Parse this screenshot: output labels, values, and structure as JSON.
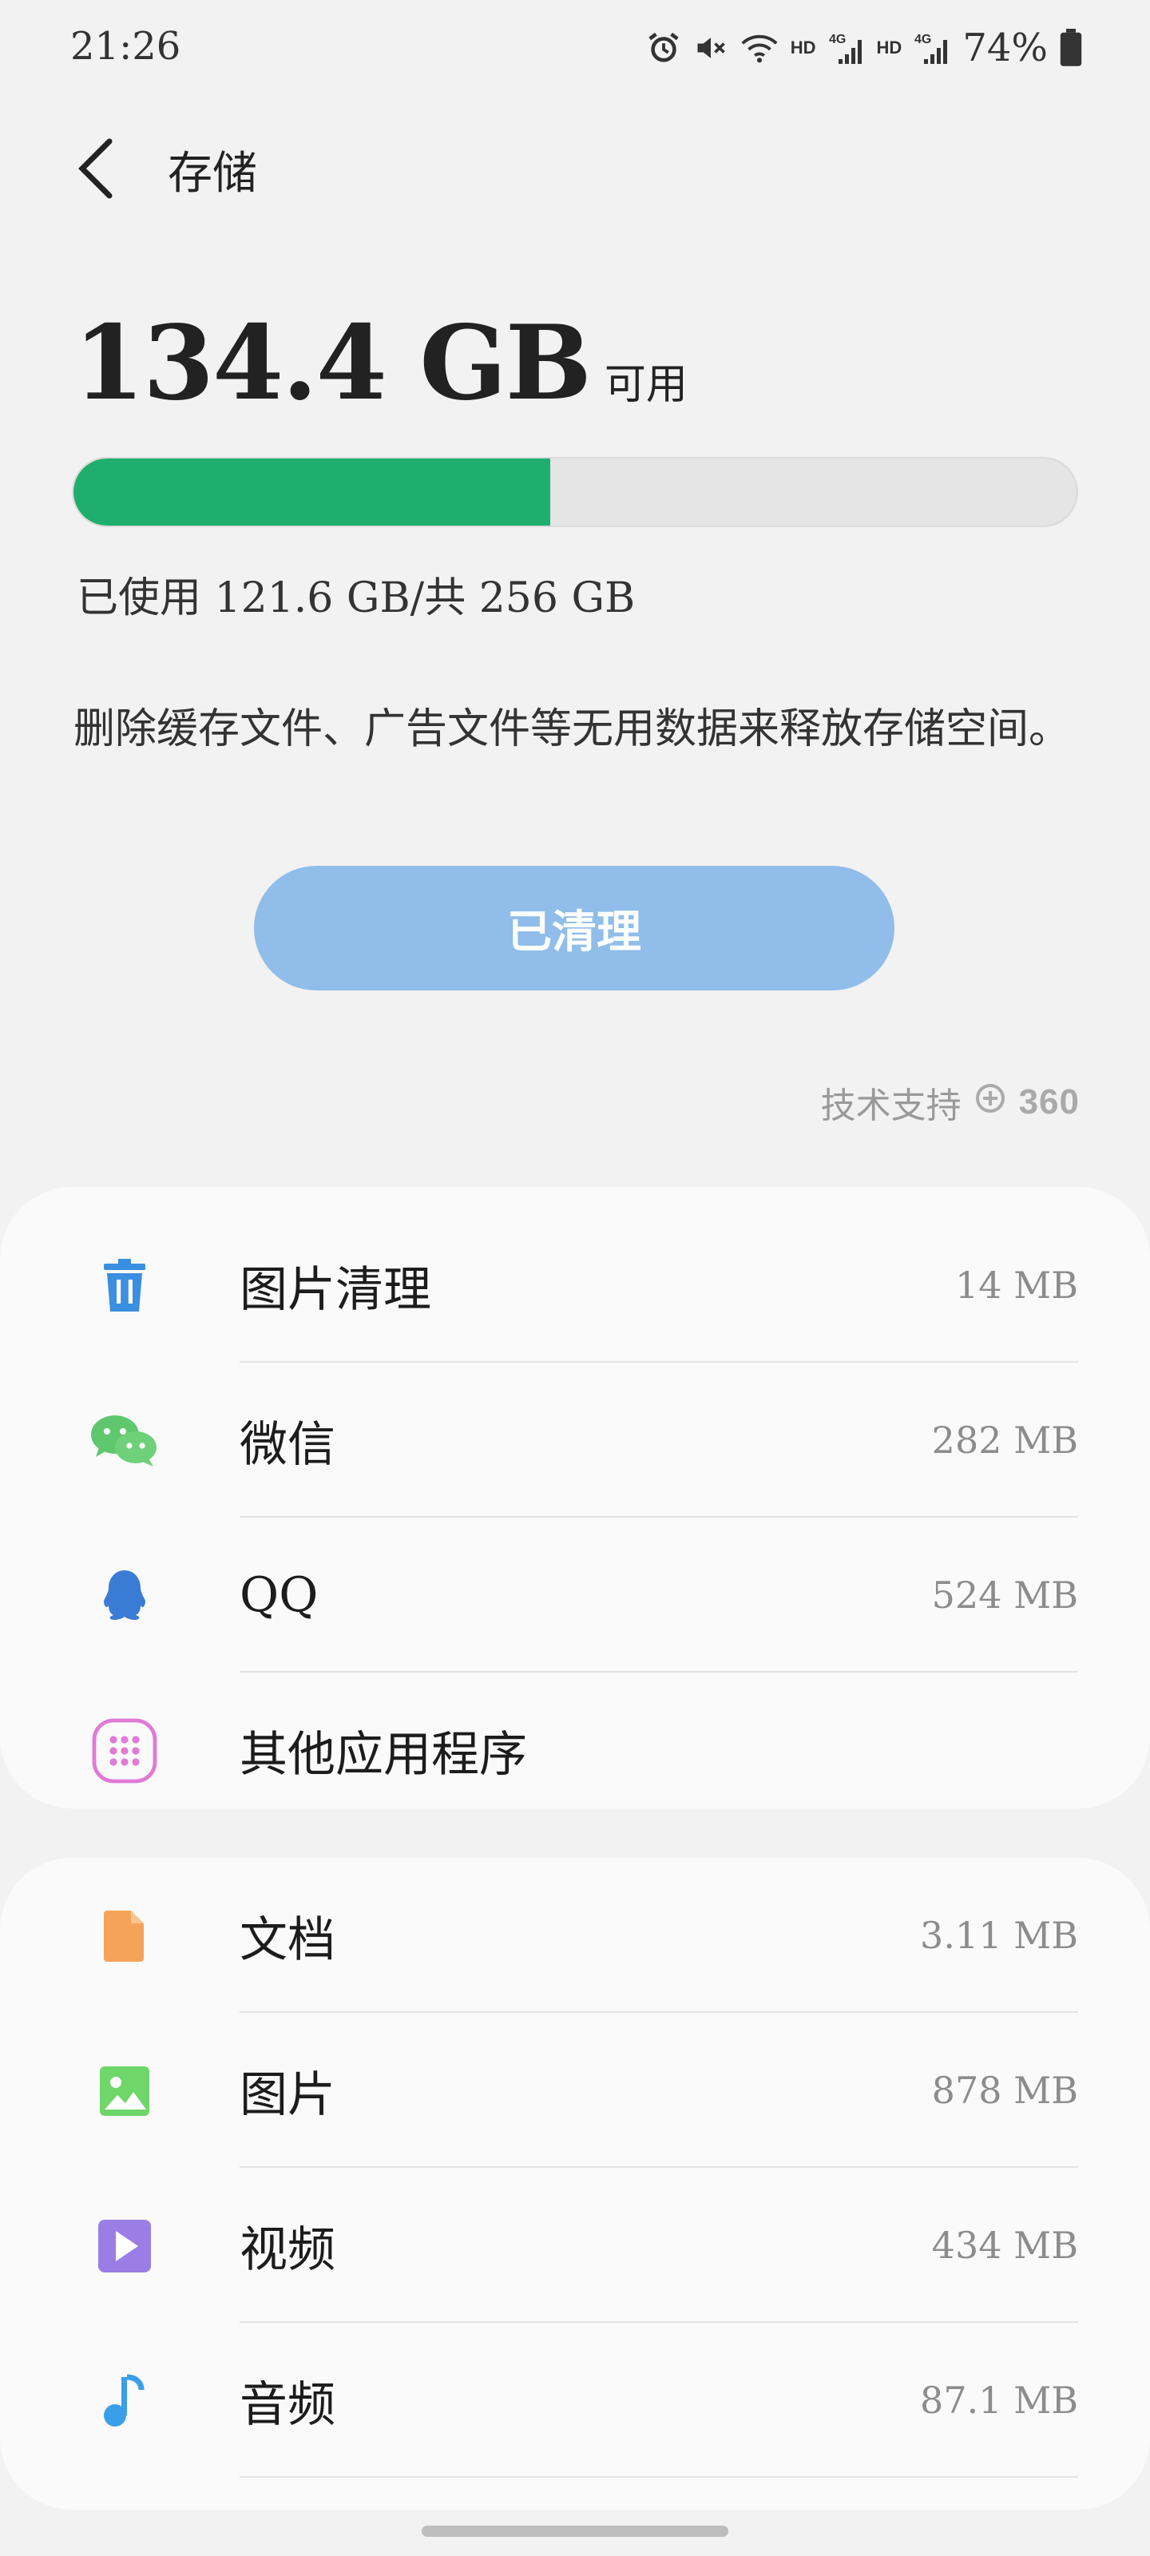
{
  "status_bar": {
    "time": "21:26",
    "hd_1": "HD",
    "net_1": "4G",
    "hd_2": "HD",
    "net_2": "4G",
    "battery": "74%",
    "icons": [
      "alarm-icon",
      "mute-icon",
      "wifi-icon",
      "signal-icon",
      "signal-icon",
      "battery-icon"
    ]
  },
  "header": {
    "title": "存储",
    "back_icon": "chevron-left-icon"
  },
  "storage": {
    "available_value": "134.4 GB",
    "available_label": "可用",
    "used_fraction": 0.475,
    "usage_text": "已使用 121.6 GB/共 256 GB",
    "bar_color": "#1fae6e"
  },
  "description": "删除缓存文件、广告文件等无用数据来释放存储空间。",
  "clean_button": {
    "label": "已清理",
    "color": "#90bde9"
  },
  "support": {
    "label": "技术支持",
    "brand": "360"
  },
  "apps_section": [
    {
      "label": "图片清理",
      "size": "14 MB",
      "icon": "trash-icon",
      "color": "#3a8fe0"
    },
    {
      "label": "微信",
      "size": "282 MB",
      "icon": "wechat-icon",
      "color": "#5fc86f"
    },
    {
      "label": "QQ",
      "size": "524 MB",
      "icon": "qq-penguin-icon",
      "color": "#3a7bd5"
    },
    {
      "label": "其他应用程序",
      "size": "",
      "icon": "apps-grid-icon",
      "color": "#e07ad6"
    }
  ],
  "files_section": [
    {
      "label": "文档",
      "size": "3.11 MB",
      "icon": "document-icon",
      "color": "#f6a35a"
    },
    {
      "label": "图片",
      "size": "878 MB",
      "icon": "image-icon",
      "color": "#6fd66a"
    },
    {
      "label": "视频",
      "size": "434 MB",
      "icon": "video-play-icon",
      "color": "#9b7de6"
    },
    {
      "label": "音频",
      "size": "87.1 MB",
      "icon": "music-note-icon",
      "color": "#3a9ee8"
    }
  ]
}
